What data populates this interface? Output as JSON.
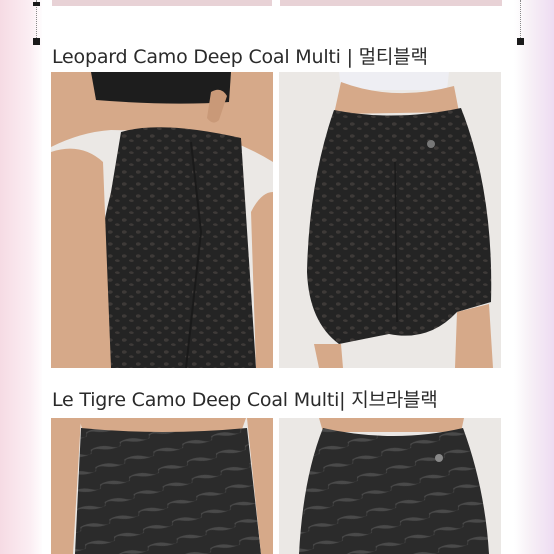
{
  "captions": {
    "top": "Leopard Camo Deep Coal Multi | 멀티블랙",
    "bottom": "Le Tigre Camo Deep Coal Multi| 지브라블랙"
  },
  "colors": {
    "fabric": "#262626",
    "fabric_pattern": "#3c3c3c",
    "skin": "#d9a98a",
    "studio_bg": "#e9e6e3"
  },
  "photos": [
    {
      "name": "leopard-front-photo"
    },
    {
      "name": "leopard-back-photo"
    },
    {
      "name": "tiger-front-photo"
    },
    {
      "name": "tiger-back-photo"
    }
  ]
}
